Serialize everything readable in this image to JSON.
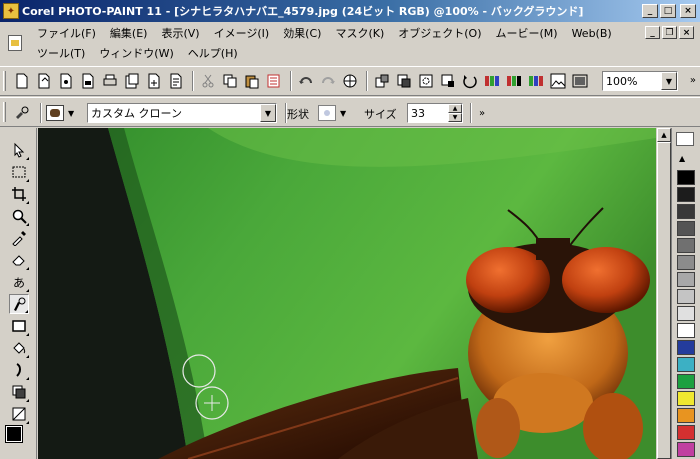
{
  "window": {
    "title": "Corel PHOTO-PAINT 11 - [シナヒラタハナバエ_4579.jpg (24ビット RGB) @100% - バックグラウンド]",
    "minimize": "_",
    "maximize": "□",
    "close": "×"
  },
  "menu": {
    "row1": [
      "ファイル(F)",
      "編集(E)",
      "表示(V)",
      "イメージ(I)",
      "効果(C)",
      "マスク(K)",
      "オブジェクト(O)",
      "ムービー(M)",
      "Web(B)"
    ],
    "row2": [
      "ツール(T)",
      "ウィンドウ(W)",
      "ヘルプ(H)"
    ],
    "mdi_minimize": "_",
    "mdi_restore": "❐",
    "mdi_close": "×"
  },
  "toolbar": {
    "zoom_value": "100%",
    "dropdown_arrow": "▼",
    "overflow": "»"
  },
  "property_bar": {
    "brush_type": "カスタム クローン",
    "shape_label": "形状",
    "size_label": "サイズ",
    "size_value": "33",
    "spin_up": "▲",
    "spin_down": "▼",
    "more": "»"
  },
  "palette": {
    "colors": [
      "#000000",
      "#1c1c1c",
      "#383838",
      "#545454",
      "#707070",
      "#8c8c8c",
      "#a8a8a8",
      "#c4c4c4",
      "#e0e0e0",
      "#ffffff",
      "#243c9c",
      "#3cb0c4",
      "#1ca040",
      "#f0e830",
      "#e89420",
      "#d43030",
      "#c040a0"
    ],
    "scroll_up": "▲"
  },
  "colors": {
    "titlebar_start": "#0a246a",
    "titlebar_end": "#a6caf0",
    "face": "#d4d0c8"
  }
}
